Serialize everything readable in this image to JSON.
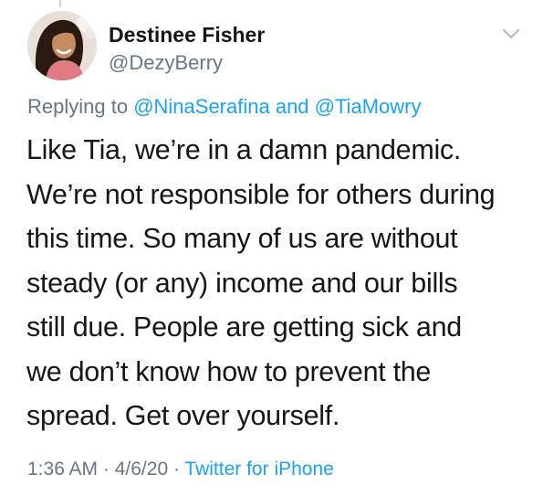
{
  "author": {
    "display_name": "Destinee Fisher",
    "handle": "@DezyBerry",
    "avatar_icon": "avatar-photo"
  },
  "reply": {
    "prefix": "Replying to ",
    "users": [
      "@NinaSerafina",
      "@TiaMowry"
    ],
    "conjunction": " and "
  },
  "tweet": {
    "lines": [
      "Like Tia, we’re in a damn pandemic.",
      "We’re not responsible for others during",
      "this time. So many of us are without",
      "steady (or any) income and our bills",
      "still due. People are getting sick and",
      "we don’t know how to prevent the",
      "spread. Get over yourself."
    ]
  },
  "meta": {
    "time": "1:36 AM",
    "separator": " · ",
    "date": "4/6/20",
    "source": "Twitter for iPhone"
  },
  "menu_icon": "chevron-down-icon",
  "colors": {
    "link": "#1da1f2",
    "secondary_text": "#657786",
    "primary_text": "#14171a",
    "thread_line": "#ccd6dd"
  }
}
